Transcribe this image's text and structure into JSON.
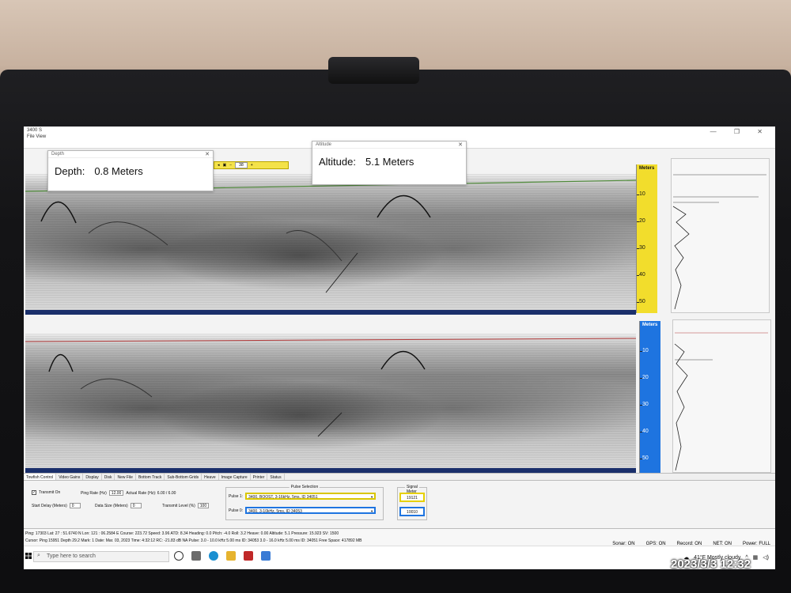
{
  "window": {
    "title": "3400 S",
    "menu": "File  View",
    "buttons": [
      "—",
      "❐",
      "✕"
    ]
  },
  "toolbar": {
    "page": "38"
  },
  "depth_popup": {
    "title": "Depth",
    "label": "Depth:",
    "value": "0.8 Meters"
  },
  "altitude_popup": {
    "title": "Altitude",
    "label": "Altitude:",
    "value": "5.1 Meters"
  },
  "scale": {
    "header": "Meters",
    "ticks": [
      "10",
      "20",
      "30",
      "40",
      "50"
    ],
    "top_color": "#f2dd2c",
    "bottom_color": "#1e74e0"
  },
  "tabs": [
    "Towfish Control",
    "Video Gains",
    "Display",
    "Disk",
    "New File",
    "Bottom Track",
    "Sub-Bottom Grids",
    "Heave",
    "Image Capture",
    "Printer",
    "Status"
  ],
  "controls": {
    "transmit_on": "Transmit On",
    "ping_rate_label": "Ping Rate (Hz)",
    "ping_rate_value": "12.00",
    "actual_rate": "Actual Rate (Hz): 6.00 / 6.00",
    "start_delay_label": "Start Delay (Meters)",
    "start_delay_value": "0",
    "data_size_label": "Data Size (Meters)",
    "data_size_value": "0",
    "transmit_level_label": "Transmit Level (%)",
    "transmit_level_value": "100",
    "pulse_selection_label": "Pulse Selection",
    "pulse1_label": "Pulse 1:",
    "pulse1_value": "3400, BOOST, 3-16kHz, 5ms, ID 34051",
    "pulse0_label": "Pulse 0:",
    "pulse0_value": "3400, 3-10kHz, 5ms, ID 34053",
    "signal_meter_label": "Signal Meter",
    "signal_meter_1": "19121",
    "signal_meter_0": "10010"
  },
  "status": {
    "row1": "Ping: 17303   Lat: 27 : 51.6740 N   Lon: 121 : 06.2584 E   Course: 223.72   Speed: 3.96   ATD: 8.34   Heading: 0.0   Pitch: -4.0   Roll: 3.2   Heave: 0.00   Altitude: 5.1   Pressure: 15.923   SV: 1500",
    "row2": "Cursor: Ping 15951 Depth 29.2   Mark: 1   Date: Mar. 03, 2023   Time: 4:32:12   RC: -21.83 dB NA   Pulse: 3.0 - 10.0 kHz   5.00 ms   ID: 34053   3.0 - 16.0 kHz   5.00 ms   ID: 34051   Free Space: 417892 MB",
    "sonar": "Sonar: ON",
    "gps": "GPS: ON",
    "record": "Record: ON",
    "net": "NET: ON",
    "power": "Power: FULL"
  },
  "taskbar": {
    "search_placeholder": "Type here to search",
    "weather": "41°F  Mostly cloudy"
  },
  "photo_stamp": "2023/3/3  12:32"
}
